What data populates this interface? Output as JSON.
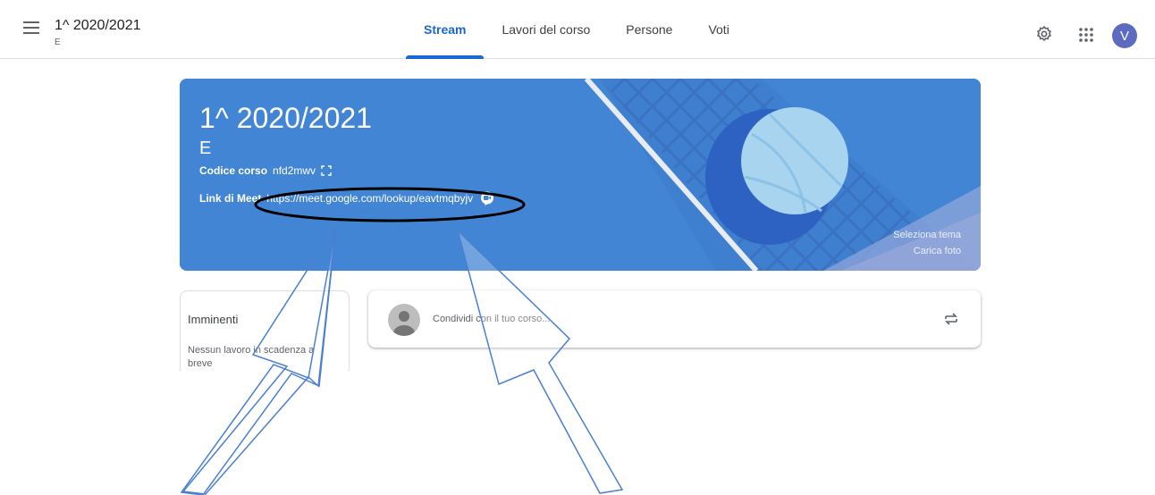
{
  "header": {
    "class_title": "1^ 2020/2021",
    "class_section": "E",
    "tabs": [
      {
        "label": "Stream",
        "active": true
      },
      {
        "label": "Lavori del corso",
        "active": false
      },
      {
        "label": "Persone",
        "active": false
      },
      {
        "label": "Voti",
        "active": false
      }
    ],
    "avatar_initial": "V"
  },
  "banner": {
    "title": "1^ 2020/2021",
    "section": "E",
    "code_label": "Codice corso",
    "code_value": "nfd2mwv",
    "meet_label": "Link di Meet",
    "meet_url": "https://meet.google.com/lookup/eavtmqbyjv",
    "select_theme": "Seleziona tema",
    "upload_photo": "Carica foto"
  },
  "upcoming": {
    "title": "Imminenti",
    "text": "Nessun lavoro in scadenza a breve"
  },
  "share": {
    "placeholder": "Condividi con il tuo corso..."
  },
  "colors": {
    "accent": "#1967d2",
    "banner": "#4285d4",
    "avatar": "#5c6bc0",
    "annotation": "#4a7fd1"
  },
  "icons": [
    "menu-icon",
    "gear-icon",
    "apps-icon",
    "expand-icon",
    "meet-video-icon",
    "repost-icon",
    "user-avatar-icon"
  ]
}
